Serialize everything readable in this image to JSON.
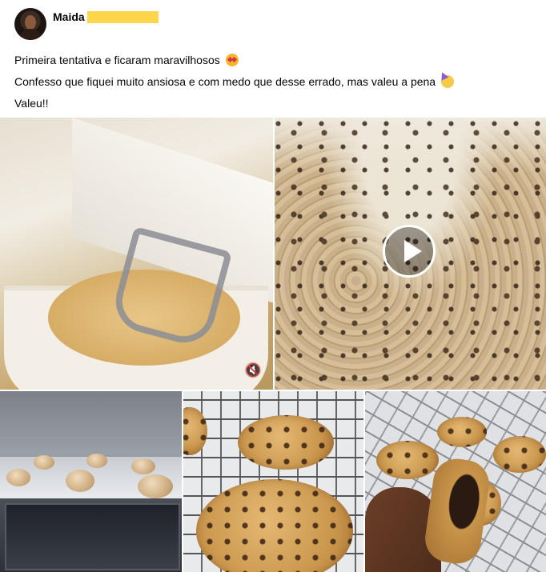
{
  "post": {
    "author": "Maida",
    "lines": [
      "Primeira tentativa e ficaram maravilhosos",
      "Confesso que fiquei muito ansiosa e com medo que desse errado, mas valeu a pena",
      "Valeu!!"
    ],
    "emojis": [
      "star-struck-emoji",
      "partying-face-emoji"
    ]
  },
  "media": {
    "items": [
      {
        "name": "mixer-photo",
        "kind": "video",
        "muted": true
      },
      {
        "name": "dough-video",
        "kind": "video",
        "play_button": true
      },
      {
        "name": "oven-photo",
        "kind": "photo"
      },
      {
        "name": "rack-cookies-photo",
        "kind": "photo"
      },
      {
        "name": "held-cookie-photo",
        "kind": "photo"
      }
    ]
  },
  "colors": {
    "redaction": "#ffd54a",
    "text": "#050505",
    "background": "#ffffff"
  }
}
